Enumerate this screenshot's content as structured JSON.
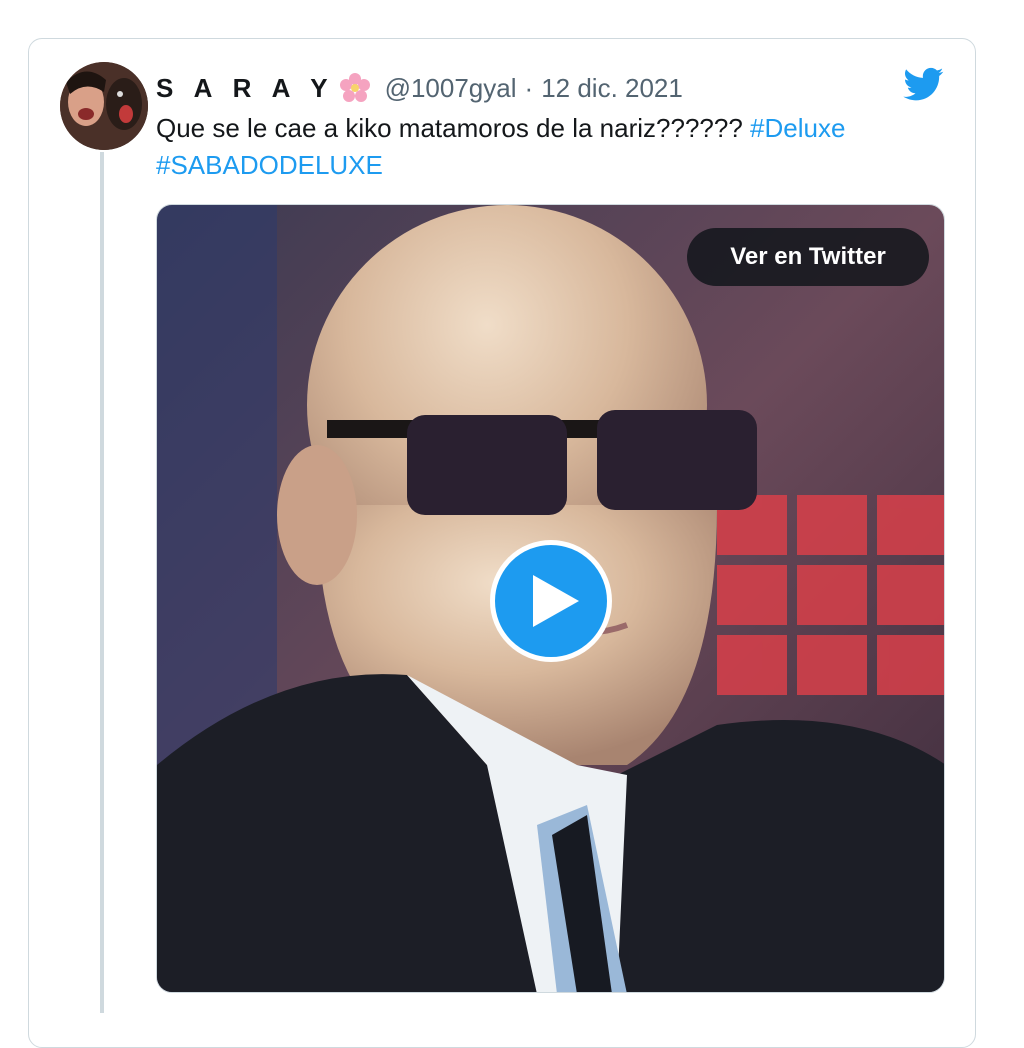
{
  "tweet": {
    "author_name": "S A R A Y",
    "author_emoji": "cherry-blossom-icon",
    "handle": "@1007gyal",
    "separator": "·",
    "date": "12 dic. 2021",
    "text": "Que se le cae a kiko matamoros de la nariz??????",
    "hashtags": [
      "#Deluxe",
      "#SABADODELUXE"
    ],
    "avatar_icon": "user-avatar",
    "logo_icon": "twitter-bird-icon"
  },
  "media": {
    "type": "video",
    "view_button_label": "Ver en Twitter",
    "play_icon": "play-icon"
  },
  "colors": {
    "accent": "#1d9bf0",
    "text": "#14171a",
    "muted": "#536471",
    "border": "#cfd9de"
  }
}
